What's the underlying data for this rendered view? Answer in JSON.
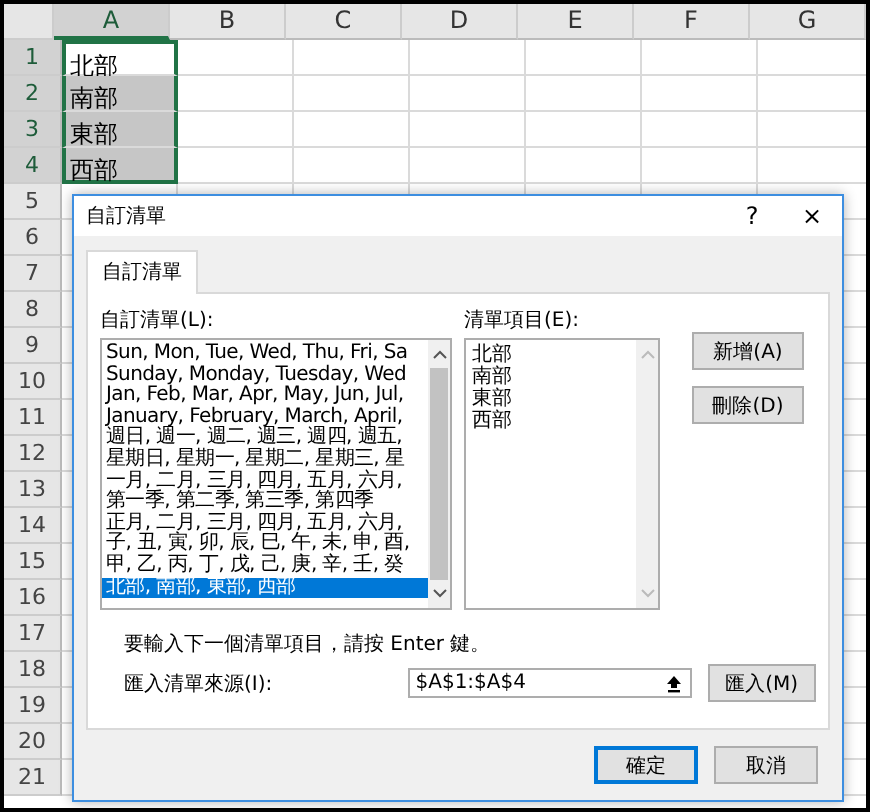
{
  "sheet": {
    "columns": [
      {
        "label": "A",
        "selected": true
      },
      {
        "label": "B",
        "selected": false
      },
      {
        "label": "C",
        "selected": false
      },
      {
        "label": "D",
        "selected": false
      },
      {
        "label": "E",
        "selected": false
      },
      {
        "label": "F",
        "selected": false
      },
      {
        "label": "G",
        "selected": false
      }
    ],
    "rows": [
      {
        "label": "1",
        "value": "北部",
        "selected": true,
        "active": true
      },
      {
        "label": "2",
        "value": "南部",
        "selected": true,
        "active": false
      },
      {
        "label": "3",
        "value": "東部",
        "selected": true,
        "active": false
      },
      {
        "label": "4",
        "value": "西部",
        "selected": true,
        "active": false
      },
      {
        "label": "5",
        "selected": false
      },
      {
        "label": "6",
        "selected": false
      },
      {
        "label": "7",
        "selected": false
      },
      {
        "label": "8",
        "selected": false
      },
      {
        "label": "9",
        "selected": false
      },
      {
        "label": "10",
        "selected": false
      },
      {
        "label": "11",
        "selected": false
      },
      {
        "label": "12",
        "selected": false
      },
      {
        "label": "13",
        "selected": false
      },
      {
        "label": "14",
        "selected": false
      },
      {
        "label": "15",
        "selected": false
      },
      {
        "label": "16",
        "selected": false
      },
      {
        "label": "17",
        "selected": false
      },
      {
        "label": "18",
        "selected": false
      },
      {
        "label": "19",
        "selected": false
      },
      {
        "label": "20",
        "selected": false
      },
      {
        "label": "21",
        "selected": false
      }
    ]
  },
  "dialog": {
    "title": "自訂清單",
    "help": "?",
    "close": "×",
    "tabs": [
      {
        "label": "自訂清單",
        "selected": true
      }
    ],
    "lists_label": "自訂清單(L):",
    "lists": [
      {
        "text": "Sun, Mon, Tue, Wed, Thu, Fri, Sa",
        "selected": false
      },
      {
        "text": "Sunday, Monday, Tuesday, Wed",
        "selected": false
      },
      {
        "text": "Jan, Feb, Mar, Apr, May, Jun, Jul,",
        "selected": false
      },
      {
        "text": "January, February, March, April,",
        "selected": false
      },
      {
        "text": "週日, 週一, 週二, 週三, 週四, 週五,",
        "selected": false
      },
      {
        "text": "星期日, 星期一, 星期二, 星期三, 星",
        "selected": false
      },
      {
        "text": "一月, 二月, 三月, 四月, 五月, 六月,",
        "selected": false
      },
      {
        "text": "第一季, 第二季, 第三季, 第四季",
        "selected": false
      },
      {
        "text": "正月, 二月, 三月, 四月, 五月, 六月,",
        "selected": false
      },
      {
        "text": "子, 丑, 寅, 卯, 辰, 巳, 午, 未, 申, 酉,",
        "selected": false
      },
      {
        "text": "甲, 乙, 丙, 丁, 戊, 己, 庚, 辛, 壬, 癸",
        "selected": false
      },
      {
        "text": "北部, 南部, 東部, 西部",
        "selected": true
      }
    ],
    "entries_label": "清單項目(E):",
    "entries": [
      "北部",
      "南部",
      "東部",
      "西部"
    ],
    "add_button": "新增(A)",
    "delete_button": "刪除(D)",
    "hint": "要輸入下一個清單項目，請按 Enter 鍵。",
    "import_label": "匯入清單來源(I):",
    "import_value": "$A$1:$A$4",
    "import_button": "匯入(M)",
    "ok_button": "確定",
    "cancel_button": "取消"
  }
}
